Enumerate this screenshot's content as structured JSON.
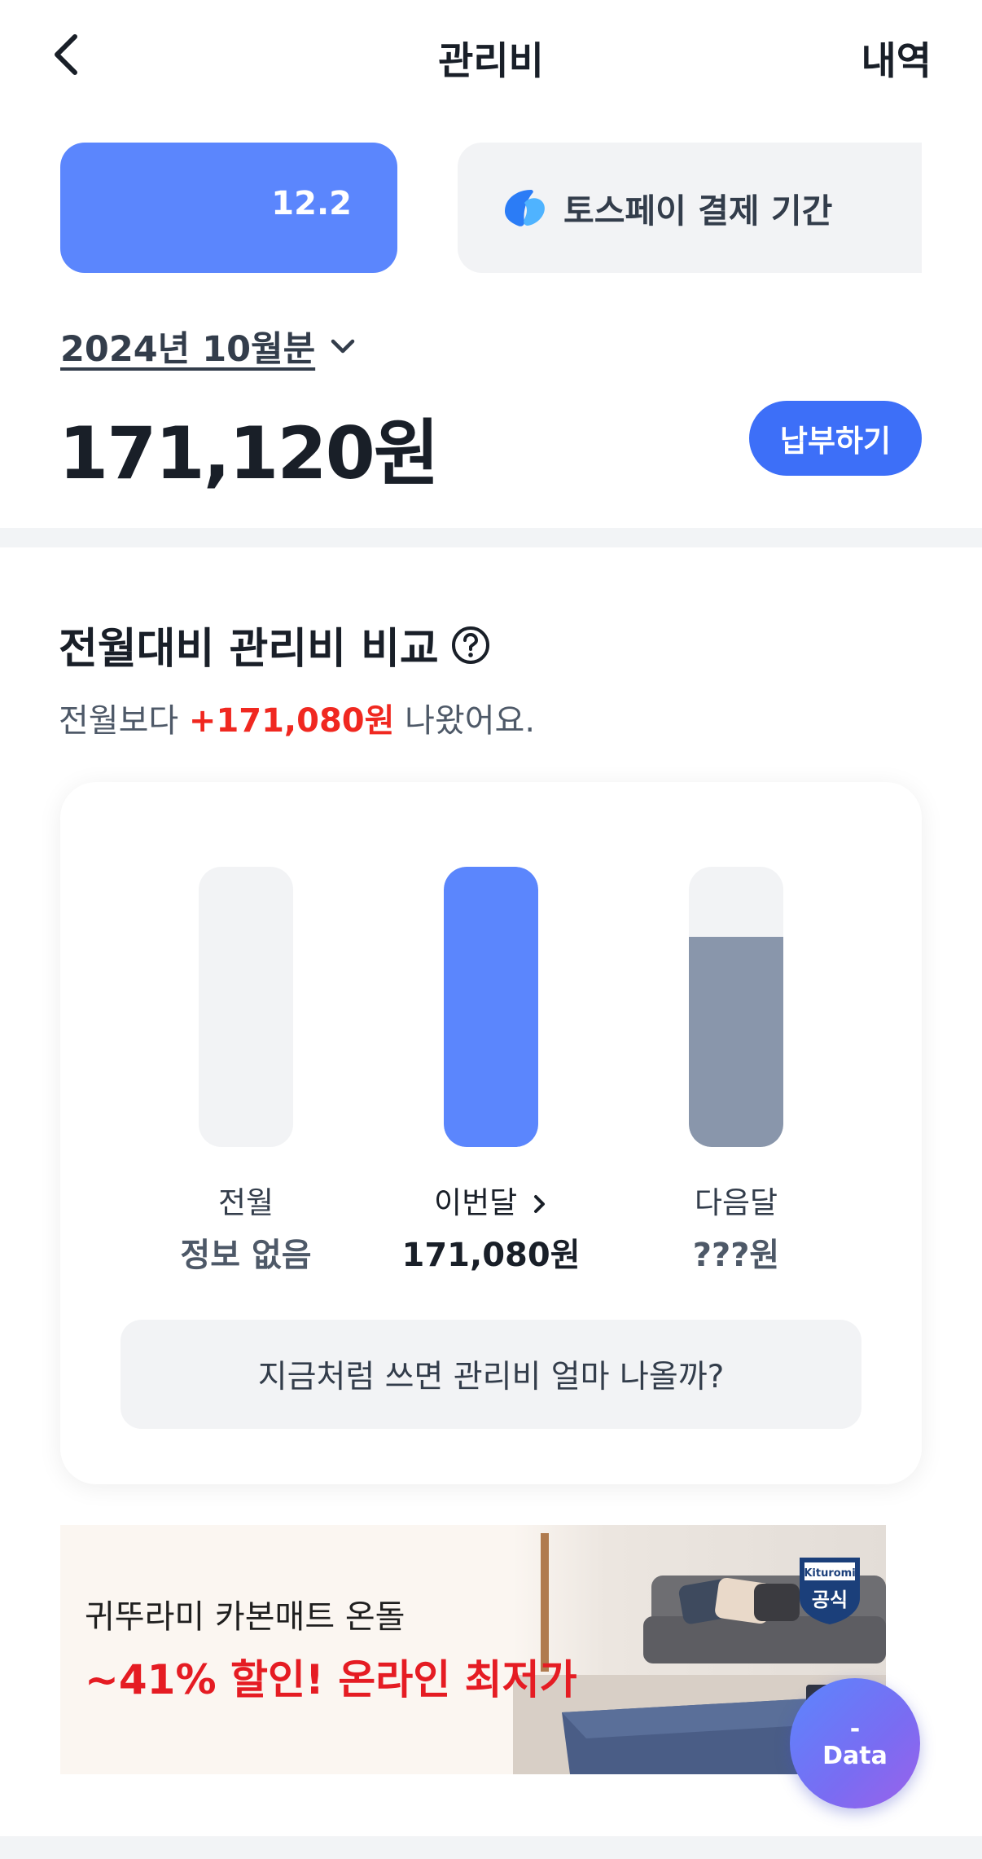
{
  "header": {
    "title": "관리비",
    "history_label": "내역"
  },
  "due_card": {
    "date": "12.2"
  },
  "tosspay_card": {
    "label": "토스페이 결제 기간"
  },
  "billing": {
    "month": "2024년 10월분",
    "total": "171,120원",
    "pay_button": "납부하기"
  },
  "comparison": {
    "title": "전월대비 관리비 비교",
    "diff_prefix": "전월보다 ",
    "diff_amount": "+171,080원",
    "diff_suffix": " 나왔어요.",
    "bars": [
      {
        "label": "전월",
        "value": "정보 없음",
        "fill": 0,
        "color": "#f2f3f5"
      },
      {
        "label": "이번달",
        "value": "171,080원",
        "fill": 1.0,
        "color": "#5b86fd"
      },
      {
        "label": "다음달",
        "value": "???원",
        "fill": 0.75,
        "color": "#8996ab"
      }
    ],
    "predict_button": "지금처럼 쓰면 관리비 얼마 나올까?"
  },
  "banner": {
    "line1": "귀뚜라미 카본매트 온돌",
    "line2": "~41% 할인! 온라인 최저가",
    "badge_brand": "Kituromi",
    "badge_text": "공식"
  },
  "fab": {
    "dash": "-",
    "label": "Data"
  },
  "colors": {
    "accent": "#3d6ff8",
    "bar_current": "#5b86fd",
    "bar_next": "#8996ab",
    "negative": "#f02820"
  }
}
